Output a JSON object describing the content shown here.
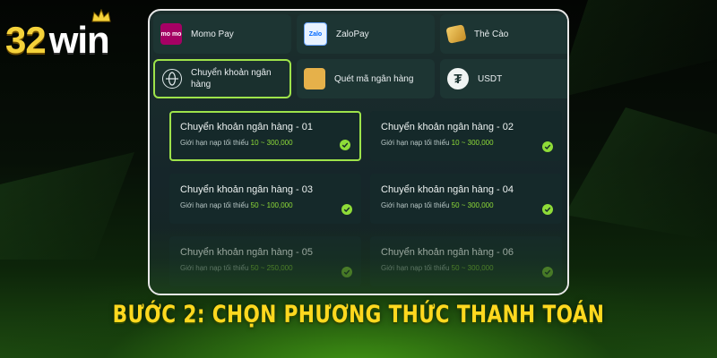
{
  "brand": {
    "logo_number": "32",
    "logo_word": "win"
  },
  "methods": [
    {
      "label": "Momo Pay",
      "icon": "momo-icon",
      "icon_text": "mo mo"
    },
    {
      "label": "ZaloPay",
      "icon": "zalopay-icon",
      "icon_text": "Zalo"
    },
    {
      "label": "Thẻ Cào",
      "icon": "scratch-card-icon"
    },
    {
      "label": "Chuyển khoản ngân hàng",
      "icon": "globe-icon",
      "selected": true
    },
    {
      "label": "Quét mã ngân hàng",
      "icon": "qr-code-icon"
    },
    {
      "label": "USDT",
      "icon": "tether-icon",
      "icon_text": "₮"
    }
  ],
  "banks": [
    {
      "title": "Chuyển khoản ngân hàng - 01",
      "limit_label": "Giới hạn nạp tối thiểu",
      "range": "10 ~ 300,000",
      "selected": true
    },
    {
      "title": "Chuyển khoản ngân hàng - 02",
      "limit_label": "Giới hạn nạp tối thiểu",
      "range": "10 ~ 300,000"
    },
    {
      "title": "Chuyển khoản ngân hàng - 03",
      "limit_label": "Giới hạn nạp tối thiểu",
      "range": "50 ~ 100,000"
    },
    {
      "title": "Chuyển khoản ngân hàng - 04",
      "limit_label": "Giới hạn nạp tối thiểu",
      "range": "50 ~ 300,000"
    },
    {
      "title": "Chuyển khoản ngân hàng - 05",
      "limit_label": "Giới hạn nạp tối thiểu",
      "range": "50 ~ 250,000"
    },
    {
      "title": "Chuyển khoản ngân hàng - 06",
      "limit_label": "Giới hạn nạp tối thiểu",
      "range": "50 ~ 300,000"
    }
  ],
  "headline": "BƯỚC 2: CHỌN PHƯƠNG THỨC THANH TOÁN",
  "colors": {
    "accent": "#9ee34a",
    "headline": "#ffd81f",
    "logo_number": "#f5d23a",
    "panel_bg": "#1c2f2d"
  }
}
